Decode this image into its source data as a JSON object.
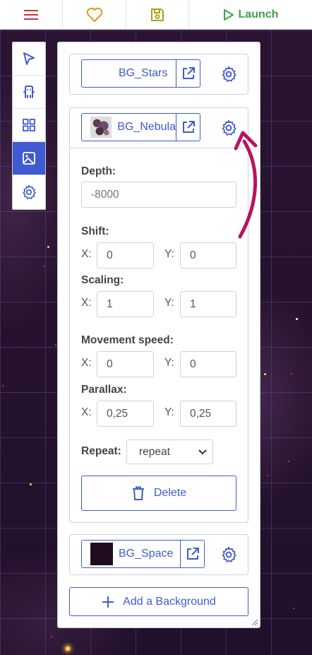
{
  "toolbar": {
    "launch_label": "Launch",
    "colors": {
      "menu": "#d62c3a",
      "favorite": "#e6931e",
      "save": "#a8a21c",
      "launch": "#3aa14a"
    }
  },
  "rail": {
    "tools": [
      "select-tool",
      "actors-tool",
      "tiles-tool",
      "backgrounds-tool",
      "settings-tool"
    ],
    "active": "backgrounds-tool"
  },
  "backgrounds": [
    {
      "name": "BG_Stars"
    },
    {
      "name": "BG_Nebula",
      "expanded": true,
      "depth_label": "Depth:",
      "depth_placeholder": "-8000",
      "shift_label": "Shift:",
      "shift": {
        "x": "0",
        "y": "0"
      },
      "scaling_label": "Scaling:",
      "scaling": {
        "x": "1",
        "y": "1"
      },
      "movement_label": "Movement speed:",
      "movement": {
        "x": "0",
        "y": "0"
      },
      "parallax_label": "Parallax:",
      "parallax": {
        "x": "0,25",
        "y": "0,25"
      },
      "repeat_label": "Repeat:",
      "repeat_value": "repeat",
      "delete_label": "Delete"
    },
    {
      "name": "BG_Space"
    }
  ],
  "axis": {
    "x": "X:",
    "y": "Y:"
  },
  "add_background_label": "Add a Background",
  "accent_color": "#3f5bcf",
  "annotation_color": "#b8145e"
}
